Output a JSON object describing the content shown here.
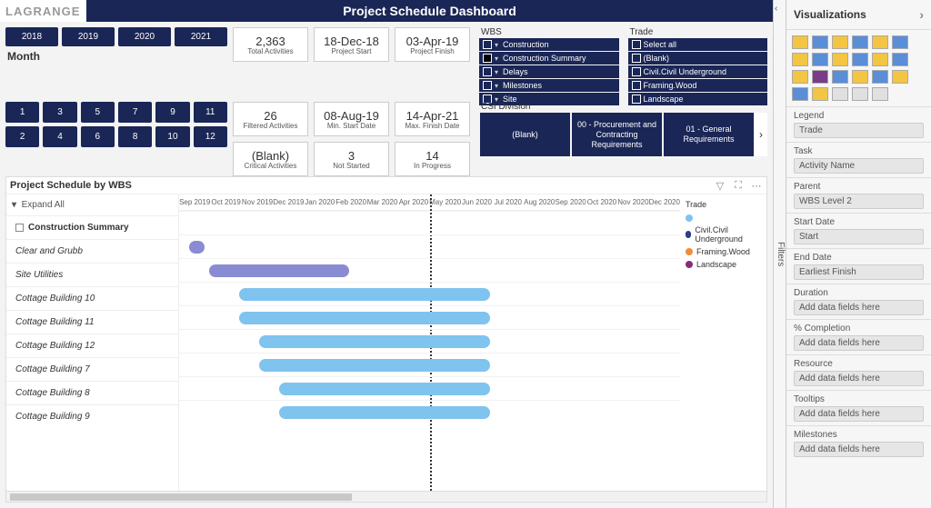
{
  "brand": "LAGRANGE",
  "title": "Project Schedule Dashboard",
  "years": [
    "2018",
    "2019",
    "2020",
    "2021"
  ],
  "month_label": "Month",
  "months_row1": [
    "1",
    "3",
    "5",
    "7",
    "9",
    "11"
  ],
  "months_row2": [
    "2",
    "4",
    "6",
    "8",
    "10",
    "12"
  ],
  "cards": [
    {
      "value": "2,363",
      "label": "Total Activities"
    },
    {
      "value": "18-Dec-18",
      "label": "Project Start"
    },
    {
      "value": "03-Apr-19",
      "label": "Project Finish"
    },
    {
      "value": "26",
      "label": "Filtered Activities"
    },
    {
      "value": "08-Aug-19",
      "label": "Min. Start Date"
    },
    {
      "value": "14-Apr-21",
      "label": "Max. Finish Date"
    },
    {
      "value": "(Blank)",
      "label": "Critical Activities"
    },
    {
      "value": "3",
      "label": "Not Started"
    },
    {
      "value": "14",
      "label": "In Progress"
    }
  ],
  "wbs": {
    "title": "WBS",
    "items": [
      {
        "label": "Construction",
        "selected": false
      },
      {
        "label": "Construction Summary",
        "selected": true
      },
      {
        "label": "Delays",
        "selected": false
      },
      {
        "label": "Milestones",
        "selected": false
      },
      {
        "label": "Site",
        "selected": false
      }
    ]
  },
  "trade": {
    "title": "Trade",
    "items": [
      {
        "label": "Select all",
        "selected": false
      },
      {
        "label": "(Blank)",
        "selected": false
      },
      {
        "label": "Civil.Civil Underground",
        "selected": false
      },
      {
        "label": "Framing.Wood",
        "selected": false
      },
      {
        "label": "Landscape",
        "selected": false
      }
    ]
  },
  "csi": {
    "title": "CSI Division",
    "items": [
      "(Blank)",
      "00 - Procurement and Contracting Requirements",
      "01 - General Requirements"
    ]
  },
  "gantt": {
    "title": "Project Schedule by WBS",
    "expand": "Expand All",
    "axis": [
      "Sep 2019",
      "Oct 2019",
      "Nov 2019",
      "Dec 2019",
      "Jan 2020",
      "Feb 2020",
      "Mar 2020",
      "Apr 2020",
      "May 2020",
      "Jun 2020",
      "Jul 2020",
      "Aug 2020",
      "Sep 2020",
      "Oct 2020",
      "Nov 2020",
      "Dec 2020"
    ],
    "header_row": "Construction Summary",
    "rows": [
      "Clear and Grubb",
      "Site Utilities",
      "Cottage Building 10",
      "Cottage Building 11",
      "Cottage Building 12",
      "Cottage Building 7",
      "Cottage Building 8",
      "Cottage Building 9"
    ],
    "legend_title": "Trade",
    "legend": [
      {
        "label": "",
        "color": "#7fc3ef"
      },
      {
        "label": "Civil.Civil Underground",
        "color": "#2a3c8a"
      },
      {
        "label": "Framing.Wood",
        "color": "#f08c3a"
      },
      {
        "label": "Landscape",
        "color": "#8a2a7a"
      }
    ]
  },
  "chart_data": {
    "type": "gantt",
    "x_axis": [
      "Sep 2019",
      "Oct 2019",
      "Nov 2019",
      "Dec 2019",
      "Jan 2020",
      "Feb 2020",
      "Mar 2020",
      "Apr 2020",
      "May 2020",
      "Jun 2020",
      "Jul 2020",
      "Aug 2020",
      "Sep 2020",
      "Oct 2020",
      "Nov 2020",
      "Dec 2020"
    ],
    "today": "May 2020",
    "tasks": [
      {
        "name": "Clear and Grubb",
        "start": "Sep 2019",
        "end": "Sep 2019",
        "trade": ""
      },
      {
        "name": "Site Utilities",
        "start": "Oct 2019",
        "end": "Feb 2020",
        "trade": "Civil.Civil Underground"
      },
      {
        "name": "Cottage Building 10",
        "start": "Nov 2019",
        "end": "Jul 2020",
        "trade": ""
      },
      {
        "name": "Cottage Building 11",
        "start": "Nov 2019",
        "end": "Jul 2020",
        "trade": ""
      },
      {
        "name": "Cottage Building 12",
        "start": "Dec 2019",
        "end": "Jul 2020",
        "trade": ""
      },
      {
        "name": "Cottage Building 7",
        "start": "Dec 2019",
        "end": "Jul 2020",
        "trade": ""
      },
      {
        "name": "Cottage Building 8",
        "start": "Jan 2020",
        "end": "Jul 2020",
        "trade": ""
      },
      {
        "name": "Cottage Building 9",
        "start": "Jan 2020",
        "end": "Jul 2020",
        "trade": ""
      }
    ]
  },
  "viz_panel": {
    "title": "Visualizations",
    "fields": [
      {
        "label": "Legend",
        "pill": "Trade"
      },
      {
        "label": "Task",
        "pill": "Activity Name"
      },
      {
        "label": "Parent",
        "pill": "WBS Level 2"
      },
      {
        "label": "Start Date",
        "pill": "Start"
      },
      {
        "label": "End Date",
        "pill": "Earliest Finish"
      },
      {
        "label": "Duration",
        "pill": "Add data fields here"
      },
      {
        "label": "% Completion",
        "pill": "Add data fields here"
      },
      {
        "label": "Resource",
        "pill": "Add data fields here"
      },
      {
        "label": "Tooltips",
        "pill": "Add data fields here"
      },
      {
        "label": "Milestones",
        "pill": "Add data fields here"
      }
    ]
  },
  "filters_tab": "Filters"
}
